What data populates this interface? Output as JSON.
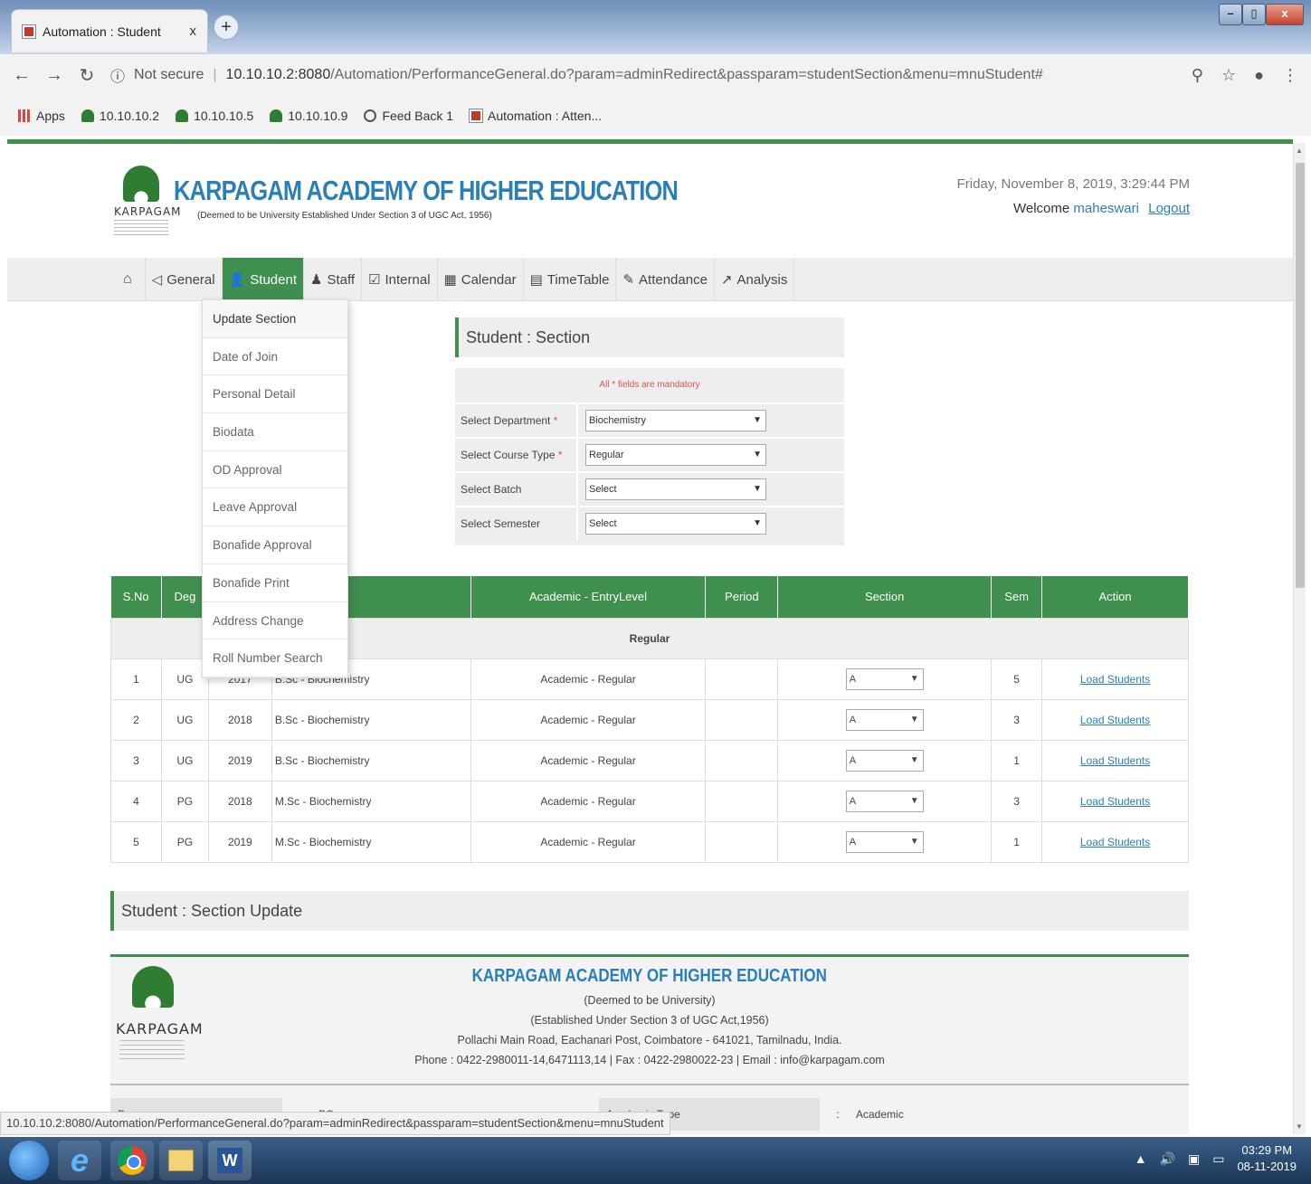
{
  "browser": {
    "tab_title": "Automation : Student",
    "tab_close": "x",
    "new_tab": "+",
    "win_min": "–",
    "win_max": "▯",
    "win_close": "x",
    "not_secure": "Not secure",
    "url_host": "10.10.10.2:8080",
    "url_path": "/Automation/PerformanceGeneral.do?param=adminRedirect&passparam=studentSection&menu=mnuStudent#",
    "bookmarks": [
      {
        "label": "Apps",
        "icon": "apps-icon"
      },
      {
        "label": "10.10.10.2",
        "icon": "site-icon"
      },
      {
        "label": "10.10.10.5",
        "icon": "site-icon"
      },
      {
        "label": "10.10.10.9",
        "icon": "site-icon"
      },
      {
        "label": "Feed Back 1",
        "icon": "globe-icon"
      },
      {
        "label": "Automation : Atten...",
        "icon": "automation-icon"
      }
    ],
    "status_url": "10.10.10.2:8080/Automation/PerformanceGeneral.do?param=adminRedirect&passparam=studentSection&menu=mnuStudent"
  },
  "header": {
    "org_name": "KARPAGAM ACADEMY OF HIGHER EDUCATION",
    "org_sub": "(Deemed to be University Established Under Section 3 of UGC Act, 1956)",
    "logo_word": "KARPAGAM",
    "datetime": "Friday, November 8, 2019, 3:29:44 PM",
    "welcome": "Welcome",
    "user": "maheswari",
    "logout": "Logout"
  },
  "menu": {
    "items": [
      {
        "label": "General",
        "icon": "send-icon"
      },
      {
        "label": "Student",
        "icon": "user-icon"
      },
      {
        "label": "Staff",
        "icon": "thumbs-icon"
      },
      {
        "label": "Internal",
        "icon": "checkbox-icon"
      },
      {
        "label": "Calendar",
        "icon": "calendar-icon"
      },
      {
        "label": "TimeTable",
        "icon": "table-icon"
      },
      {
        "label": "Attendance",
        "icon": "edit-icon"
      },
      {
        "label": "Analysis",
        "icon": "chart-icon"
      }
    ],
    "dropdown": [
      "Update Section",
      "Date of Join",
      "Personal Detail",
      "Biodata",
      "OD Approval",
      "Leave Approval",
      "Bonafide Approval",
      "Bonafide Print",
      "Address Change",
      "Roll Number Search"
    ]
  },
  "form": {
    "title": "Student : Section",
    "mandatory_note": "All * fields are mandatory",
    "fields": [
      {
        "label": "Select Department",
        "required": "*",
        "value": "Biochemistry"
      },
      {
        "label": "Select Course Type",
        "required": "*",
        "value": "Regular"
      },
      {
        "label": "Select Batch",
        "required": "",
        "value": "Select"
      },
      {
        "label": "Select Semester",
        "required": "",
        "value": "Select"
      }
    ]
  },
  "table": {
    "headers": [
      "S.No",
      "Deg",
      "",
      "anch - Course",
      "Academic - EntryLevel",
      "Period",
      "Section",
      "Sem",
      "Action"
    ],
    "group": "Regular",
    "rows": [
      {
        "sno": "1",
        "deg": "UG",
        "year": "2017",
        "course": "B.Sc - Biochemistry",
        "entry": "Academic - Regular",
        "period": "",
        "section": "A",
        "sem": "5",
        "action": "Load Students"
      },
      {
        "sno": "2",
        "deg": "UG",
        "year": "2018",
        "course": "B.Sc - Biochemistry",
        "entry": "Academic - Regular",
        "period": "",
        "section": "A",
        "sem": "3",
        "action": "Load Students"
      },
      {
        "sno": "3",
        "deg": "UG",
        "year": "2019",
        "course": "B.Sc - Biochemistry",
        "entry": "Academic - Regular",
        "period": "",
        "section": "A",
        "sem": "1",
        "action": "Load Students"
      },
      {
        "sno": "4",
        "deg": "PG",
        "year": "2018",
        "course": "M.Sc - Biochemistry",
        "entry": "Academic - Regular",
        "period": "",
        "section": "A",
        "sem": "3",
        "action": "Load Students"
      },
      {
        "sno": "5",
        "deg": "PG",
        "year": "2019",
        "course": "M.Sc - Biochemistry",
        "entry": "Academic - Regular",
        "period": "",
        "section": "A",
        "sem": "1",
        "action": "Load Students"
      }
    ]
  },
  "update": {
    "title": "Student : Section Update",
    "report": {
      "name": "KARPAGAM ACADEMY OF HIGHER EDUCATION",
      "logo_word": "KARPAGAM",
      "line1": "(Deemed to be University)",
      "line2": "(Established Under Section 3 of UGC Act,1956)",
      "line3": "Pollachi Main Road, Eachanari Post, Coimbatore - 641021, Tamilnadu, India.",
      "line4": "Phone : 0422-2980011-14,6471113,14 | Fax : 0422-2980022-23 | Email : info@karpagam.com",
      "field1_label": "Degree",
      "field1_value": "PG",
      "field2_label": "Academic Type",
      "field2_value": "Academic",
      "colon": ":"
    }
  },
  "taskbar": {
    "time": "03:29 PM",
    "date": "08-11-2019"
  }
}
